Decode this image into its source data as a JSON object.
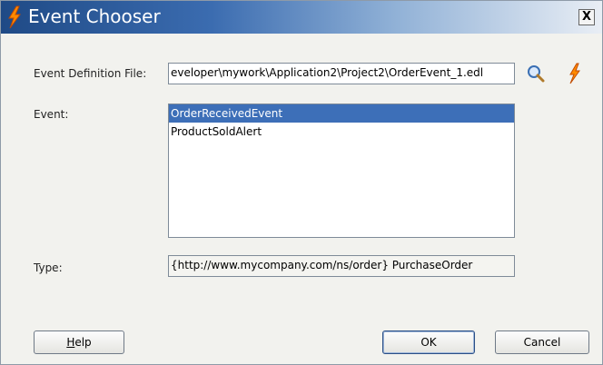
{
  "dialog": {
    "title": "Event Chooser",
    "close_label": "X"
  },
  "form": {
    "event_definition_label": "Event Definition File:",
    "event_definition_value": "eveloper\\mywork\\Application2\\Project2\\OrderEvent_1.edl",
    "event_label": "Event:",
    "events": [
      {
        "label": "OrderReceivedEvent",
        "selected": true
      },
      {
        "label": "ProductSoldAlert",
        "selected": false
      }
    ],
    "type_label": "Type:",
    "type_value": "{http://www.mycompany.com/ns/order} PurchaseOrder"
  },
  "buttons": {
    "help_mnemonic": "H",
    "help_rest": "elp",
    "ok": "OK",
    "cancel": "Cancel"
  },
  "icons": {
    "title": "lightning-bolt-icon",
    "search": "magnifier-icon",
    "create": "lightning-bolt-icon"
  }
}
